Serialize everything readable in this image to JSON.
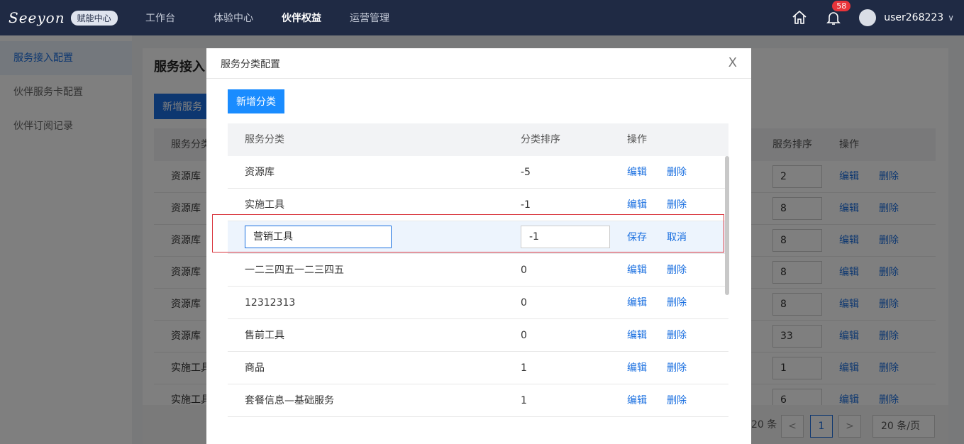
{
  "header": {
    "logo_text": "Seeyon",
    "logo_badge": "赋能中心",
    "nav": [
      "工作台",
      "体验中心",
      "伙伴权益",
      "运营管理"
    ],
    "active_nav": "伙伴权益",
    "notification_count": "58",
    "username": "user268223"
  },
  "sidebar": {
    "items": [
      "服务接入配置",
      "伙伴服务卡配置",
      "伙伴订阅记录"
    ]
  },
  "main": {
    "title": "服务接入",
    "add_button": "新增服务",
    "columns": {
      "category": "服务分类",
      "sort": "服务排序",
      "action": "操作"
    },
    "rows": [
      {
        "category": "资源库",
        "sort": "2"
      },
      {
        "category": "资源库",
        "sort": "8"
      },
      {
        "category": "资源库",
        "sort": "8"
      },
      {
        "category": "资源库",
        "sort": "8"
      },
      {
        "category": "资源库",
        "sort": "8"
      },
      {
        "category": "资源库",
        "sort": "33"
      },
      {
        "category": "实施工具",
        "sort": "1"
      },
      {
        "category": "实施工具",
        "sort": "6"
      }
    ],
    "edit_label": "编辑",
    "delete_label": "删除",
    "pager": {
      "total": "20 条",
      "prev": "<",
      "current": "1",
      "next": ">",
      "page_size": "20 条/页"
    }
  },
  "modal": {
    "title": "服务分类配置",
    "close": "X",
    "add_button": "新增分类",
    "columns": {
      "category": "服务分类",
      "sort": "分类排序",
      "action": "操作"
    },
    "rows": [
      {
        "category": "资源库",
        "sort": "-5"
      },
      {
        "category": "实施工具",
        "sort": "-1"
      },
      {
        "category": "营销工具",
        "sort": "-1",
        "editing": true
      },
      {
        "category": "一二三四五一二三四五",
        "sort": "0"
      },
      {
        "category": "12312313",
        "sort": "0"
      },
      {
        "category": "售前工具",
        "sort": "0"
      },
      {
        "category": "商品",
        "sort": "1"
      },
      {
        "category": "套餐信息—基础服务",
        "sort": "1"
      }
    ],
    "edit_label": "编辑",
    "delete_label": "删除",
    "save_label": "保存",
    "cancel_label": "取消"
  }
}
